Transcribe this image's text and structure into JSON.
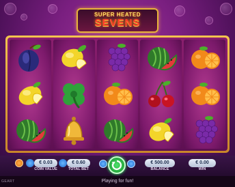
{
  "game": {
    "title_line1": "SUPER HEATED",
    "title_line2": "SEVENS"
  },
  "reels": [
    [
      "plum-icon",
      "lemon-icon",
      "watermelon-icon"
    ],
    [
      "lemon-icon",
      "clover-icon",
      "bell-icon"
    ],
    [
      "grapes-icon",
      "orange-icon",
      "watermelon-icon"
    ],
    [
      "watermelon-icon",
      "cherries-icon",
      "lemon-icon"
    ],
    [
      "orange-icon",
      "orange-icon",
      "grapes-icon"
    ]
  ],
  "controls": {
    "coin_value": "€ 0.03",
    "coin_value_label": "COIN VALUE",
    "total_bet": "€ 0.60",
    "total_bet_label": "TOTAL BET",
    "balance": "€ 500.00",
    "balance_label": "BALANCE",
    "win": "€ 0.00",
    "win_label": "WIN"
  },
  "footer": {
    "status": "Playing for fun!",
    "brand": "GEART"
  },
  "colors": {
    "frame_gold": "#e8b43a",
    "spin_green": "#2fbf4a",
    "background_purple": "#7a1f80"
  }
}
